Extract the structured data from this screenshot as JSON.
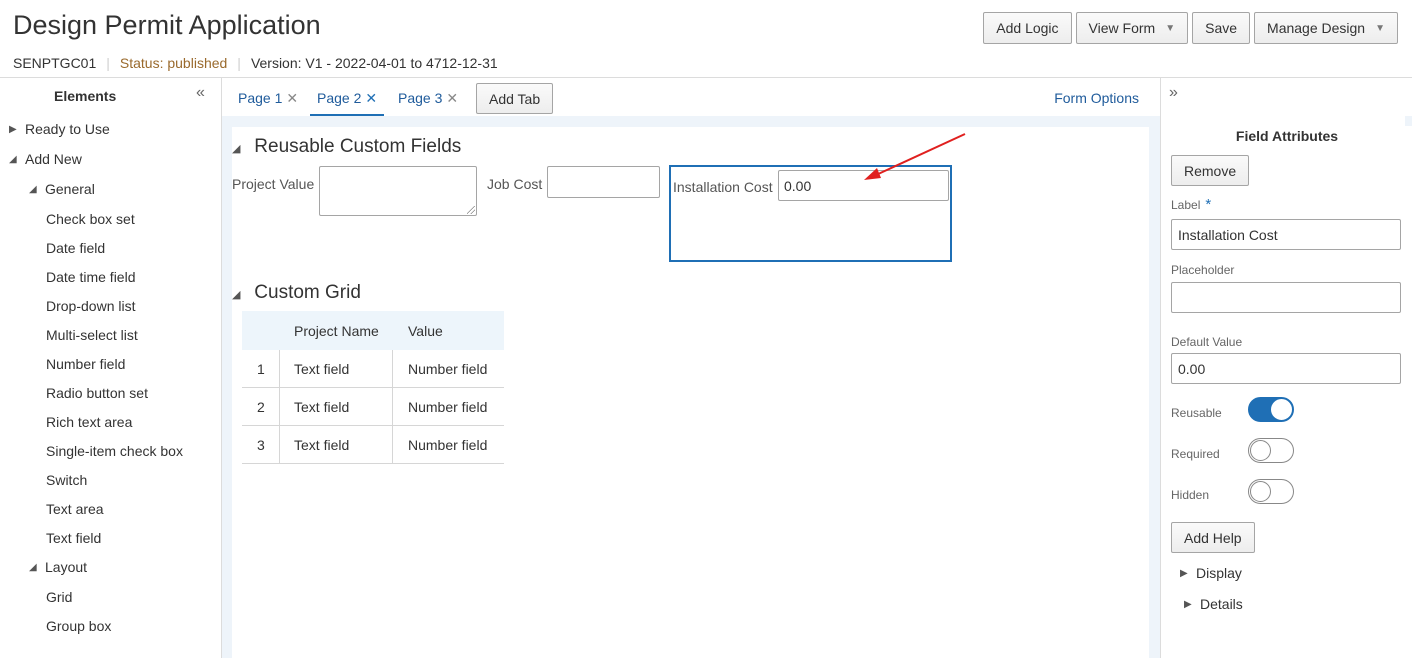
{
  "header": {
    "title": "Design Permit Application",
    "code": "SENPTGC01",
    "status": "Status: published",
    "version": "Version: V1 - 2022-04-01 to 4712-12-31",
    "actions": {
      "add_logic": "Add Logic",
      "view_form": "View Form",
      "save": "Save",
      "manage_design": "Manage Design"
    }
  },
  "sidebar": {
    "title": "Elements",
    "ready_to_use": "Ready to Use",
    "add_new": "Add New",
    "general": "General",
    "general_items": [
      "Check box set",
      "Date field",
      "Date time field",
      "Drop-down list",
      "Multi-select list",
      "Number field",
      "Radio button set",
      "Rich text area",
      "Single-item check box",
      "Switch",
      "Text area",
      "Text field"
    ],
    "layout": "Layout",
    "layout_items": [
      "Grid",
      "Group box"
    ]
  },
  "tabs": {
    "items": [
      "Page 1",
      "Page 2",
      "Page 3"
    ],
    "active": "Page 2",
    "add_tab": "Add Tab",
    "form_options": "Form Options"
  },
  "canvas": {
    "section1": {
      "title": "Reusable Custom Fields",
      "project_value_label": "Project Value",
      "job_cost_label": "Job Cost",
      "installation_cost_label": "Installation Cost",
      "installation_cost_value": "0.00"
    },
    "section2": {
      "title": "Custom Grid",
      "columns": [
        "Project Name",
        "Value"
      ],
      "rows": [
        {
          "num": "1",
          "name": "Text field",
          "value": "Number field"
        },
        {
          "num": "2",
          "name": "Text field",
          "value": "Number field"
        },
        {
          "num": "3",
          "name": "Text field",
          "value": "Number field"
        }
      ]
    }
  },
  "right_panel": {
    "title": "Field Attributes",
    "remove": "Remove",
    "label_caption": "Label",
    "label_required_mark": "*",
    "label_value": "Installation Cost",
    "placeholder_caption": "Placeholder",
    "placeholder_value": "",
    "default_value_caption": "Default Value",
    "default_value": "0.00",
    "reusable": "Reusable",
    "required": "Required",
    "hidden": "Hidden",
    "toggles": {
      "reusable": true,
      "required": false,
      "hidden": false
    },
    "add_help": "Add Help",
    "display": "Display",
    "details": "Details"
  },
  "colors": {
    "accent": "#1f6fb5",
    "link": "#1f5b9b",
    "status": "#9a6a2d",
    "annotation_arrow": "#e0201f",
    "canvas_bg": "#eef4fa"
  }
}
